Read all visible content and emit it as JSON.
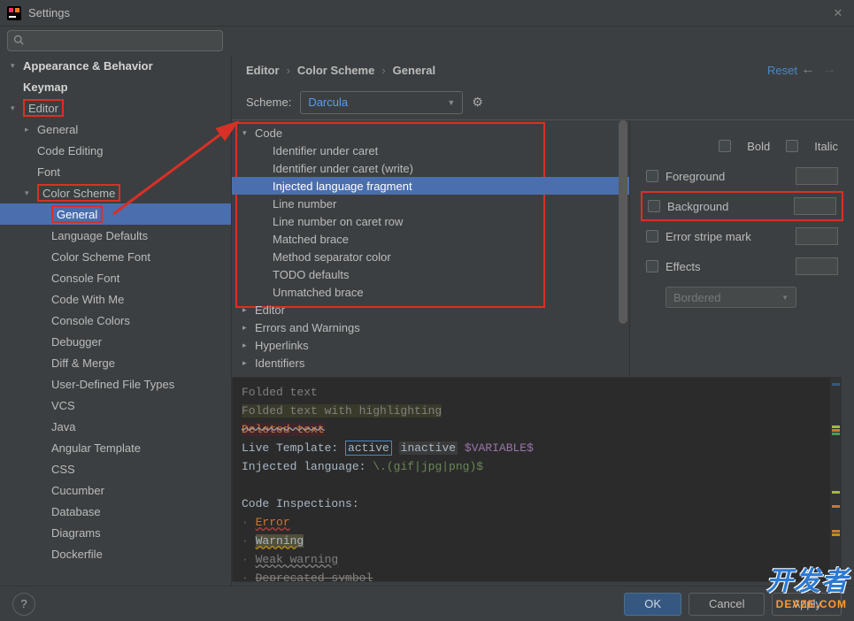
{
  "window": {
    "title": "Settings"
  },
  "search": {
    "placeholder": ""
  },
  "sidebar": {
    "items": [
      {
        "label": "Appearance & Behavior",
        "level": 0,
        "arrow": "▾",
        "bold": true
      },
      {
        "label": "Keymap",
        "level": 0,
        "arrow": "",
        "bold": true
      },
      {
        "label": "Editor",
        "level": 0,
        "arrow": "▾",
        "bold": true,
        "red": true
      },
      {
        "label": "General",
        "level": 1,
        "arrow": "▸"
      },
      {
        "label": "Code Editing",
        "level": 1,
        "arrow": ""
      },
      {
        "label": "Font",
        "level": 1,
        "arrow": ""
      },
      {
        "label": "Color Scheme",
        "level": 1,
        "arrow": "▾",
        "red": true
      },
      {
        "label": "General",
        "level": 2,
        "arrow": "",
        "selected": true,
        "red": true
      },
      {
        "label": "Language Defaults",
        "level": 2,
        "arrow": ""
      },
      {
        "label": "Color Scheme Font",
        "level": 2,
        "arrow": ""
      },
      {
        "label": "Console Font",
        "level": 2,
        "arrow": ""
      },
      {
        "label": "Code With Me",
        "level": 2,
        "arrow": ""
      },
      {
        "label": "Console Colors",
        "level": 2,
        "arrow": ""
      },
      {
        "label": "Debugger",
        "level": 2,
        "arrow": ""
      },
      {
        "label": "Diff & Merge",
        "level": 2,
        "arrow": ""
      },
      {
        "label": "User-Defined File Types",
        "level": 2,
        "arrow": ""
      },
      {
        "label": "VCS",
        "level": 2,
        "arrow": ""
      },
      {
        "label": "Java",
        "level": 2,
        "arrow": ""
      },
      {
        "label": "Angular Template",
        "level": 2,
        "arrow": ""
      },
      {
        "label": "CSS",
        "level": 2,
        "arrow": ""
      },
      {
        "label": "Cucumber",
        "level": 2,
        "arrow": ""
      },
      {
        "label": "Database",
        "level": 2,
        "arrow": ""
      },
      {
        "label": "Diagrams",
        "level": 2,
        "arrow": ""
      },
      {
        "label": "Dockerfile",
        "level": 2,
        "arrow": ""
      }
    ]
  },
  "breadcrumb": {
    "a": "Editor",
    "b": "Color Scheme",
    "c": "General",
    "sep": "›"
  },
  "actions": {
    "reset": "Reset"
  },
  "scheme": {
    "label": "Scheme:",
    "value": "Darcula"
  },
  "categories": {
    "items": [
      {
        "label": "Code",
        "level": 0,
        "arrow": "▾"
      },
      {
        "label": "Identifier under caret",
        "level": 2
      },
      {
        "label": "Identifier under caret (write)",
        "level": 2
      },
      {
        "label": "Injected language fragment",
        "level": 2,
        "selected": true
      },
      {
        "label": "Line number",
        "level": 2
      },
      {
        "label": "Line number on caret row",
        "level": 2
      },
      {
        "label": "Matched brace",
        "level": 2
      },
      {
        "label": "Method separator color",
        "level": 2
      },
      {
        "label": "TODO defaults",
        "level": 2
      },
      {
        "label": "Unmatched brace",
        "level": 2
      },
      {
        "label": "Editor",
        "level": 0,
        "arrow": "▸"
      },
      {
        "label": "Errors and Warnings",
        "level": 0,
        "arrow": "▸"
      },
      {
        "label": "Hyperlinks",
        "level": 0,
        "arrow": "▸"
      },
      {
        "label": "Identifiers",
        "level": 0,
        "arrow": "▸"
      }
    ]
  },
  "props": {
    "bold": "Bold",
    "italic": "Italic",
    "foreground": "Foreground",
    "background": "Background",
    "errorstripe": "Error stripe mark",
    "effects": "Effects",
    "effecttype": "Bordered"
  },
  "preview": {
    "l1": "Folded text",
    "l2": "Folded text with highlighting",
    "l3": "Deleted text",
    "l4a": "Live Template: ",
    "l4b": "active",
    "l4c": "inactive",
    "l4d": "$VARIABLE$",
    "l5a": "Injected language: ",
    "l5b": "\\.(gif|jpg|png)$",
    "l6": "Code Inspections:",
    "l7": "Error",
    "l8": "Warning",
    "l9": "Weak warning",
    "l10": "Deprecated symbol"
  },
  "buttons": {
    "ok": "OK",
    "cancel": "Cancel",
    "apply": "Apply",
    "help": "?"
  },
  "watermark": {
    "big": "开发者",
    "small": "DEVZE.COM"
  }
}
